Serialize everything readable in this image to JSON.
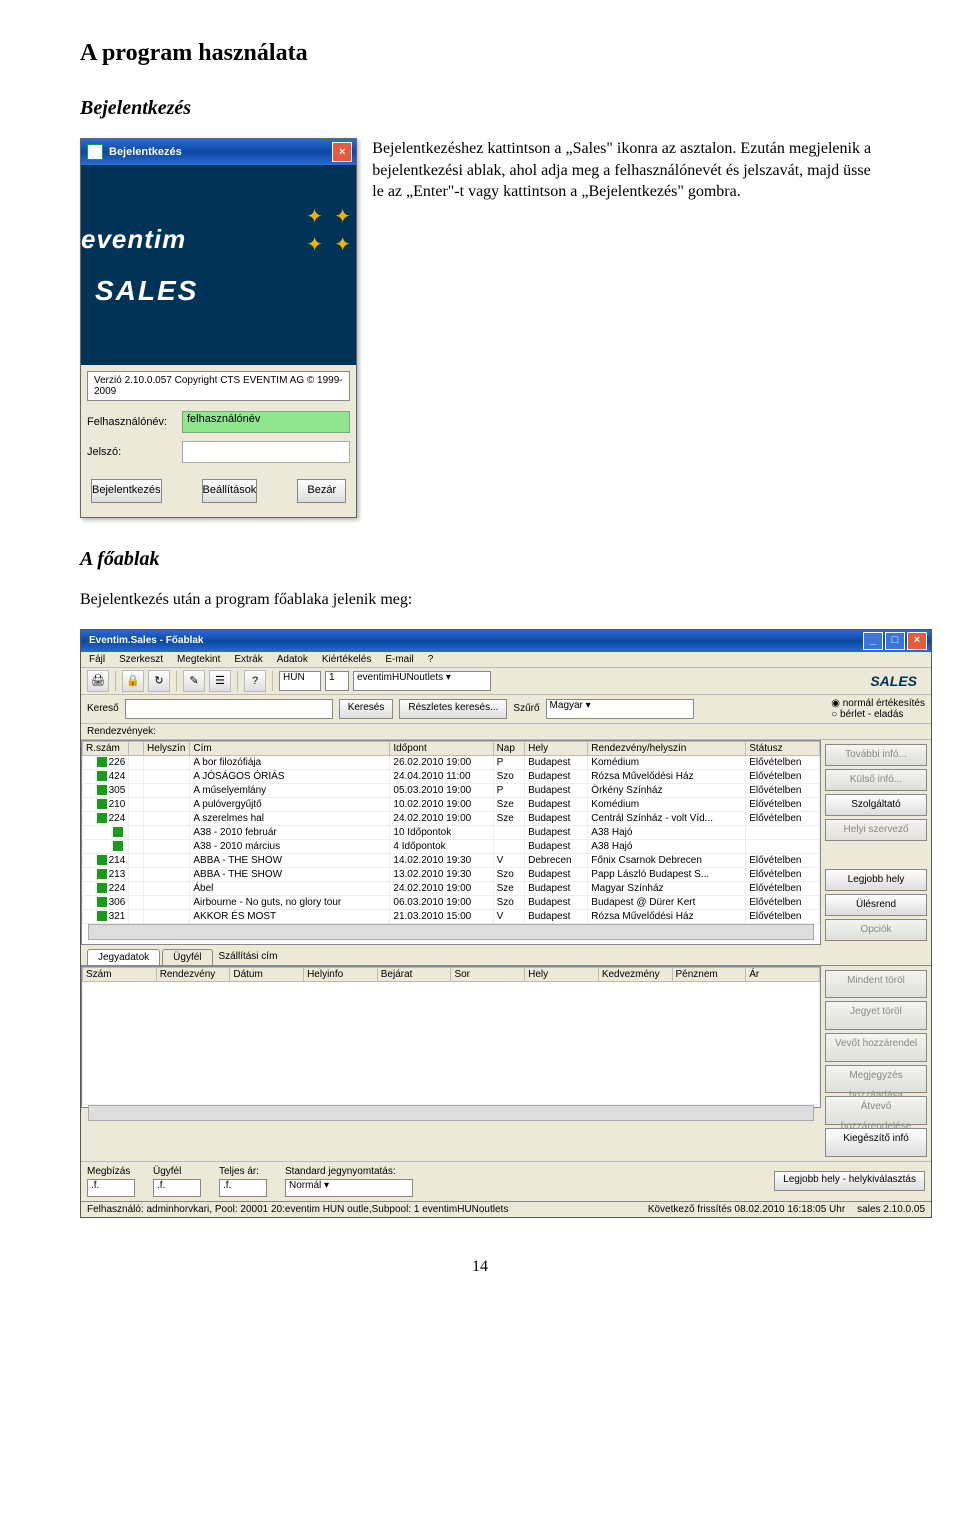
{
  "doc": {
    "title": "A program használata",
    "section1": "Bejelentkezés",
    "para1": "Bejelentkezéshez kattintson a „Sales\" ikonra az asztalon. Ezután megjelenik a bejelentkezési ablak, ahol adja meg a felhasználónevét és jelszavát, majd üsse le az „Enter\"-t vagy kattintson a „Bejelentkezés\" gombra.",
    "section2": "A főablak",
    "para2": "Bejelentkezés után a program főablaka jelenik meg:",
    "page_number": "14"
  },
  "login": {
    "window_title": "Bejelentkezés",
    "brand": "eventim",
    "sales": "SALES",
    "version": "Verzió 2.10.0.057 Copyright CTS EVENTIM AG © 1999-2009",
    "user_label": "Felhasználónév:",
    "user_value": "felhasználónév",
    "pw_label": "Jelszó:",
    "pw_value": "",
    "btn_login": "Bejelentkezés",
    "btn_settings": "Beállítások",
    "btn_close": "Bezár"
  },
  "main": {
    "window_title": "Eventim.Sales - Főablak",
    "menu": [
      "Fájl",
      "Szerkeszt",
      "Megtekint",
      "Extrák",
      "Adatok",
      "Kiértékelés",
      "E-mail",
      "?"
    ],
    "toolbar": {
      "lang": "HUN",
      "one": "1",
      "outlet": "eventimHUNoutlets",
      "sales_logo": "SALES"
    },
    "search": {
      "kereso_label": "Kereső",
      "btn_search": "Keresés",
      "btn_detail": "Részletes keresés...",
      "filter_label": "Szűrő",
      "filter_value": "Magyar",
      "radio1": "normál értékesítés",
      "radio2": "bérlet - eladás"
    },
    "events_label": "Rendezvények:",
    "columns": [
      "R.szám",
      "",
      "Helyszín",
      "Cím",
      "Időpont",
      "Nap",
      "Hely",
      "Rendezvény/helyszín",
      "Státusz"
    ],
    "rows": [
      {
        "n": "226",
        "cim": "A bor filozófiája",
        "ido": "26.02.2010 19:00",
        "nap": "P",
        "hely": "Budapest",
        "rv": "Komédium",
        "st": "Elővételben"
      },
      {
        "n": "424",
        "cim": "A JÓSÁGOS ÓRIÁS",
        "ido": "24.04.2010 11:00",
        "nap": "Szo",
        "hely": "Budapest",
        "rv": "Rózsa Művelődési Ház",
        "st": "Elővételben"
      },
      {
        "n": "305",
        "cim": "A műselyemlány",
        "ido": "05.03.2010 19:00",
        "nap": "P",
        "hely": "Budapest",
        "rv": "Örkény Színház",
        "st": "Elővételben"
      },
      {
        "n": "210",
        "cim": "A pulóvergyűjtő",
        "ido": "10.02.2010 19:00",
        "nap": "Sze",
        "hely": "Budapest",
        "rv": "Komédium",
        "st": "Elővételben"
      },
      {
        "n": "224",
        "cim": "A szerelmes hal",
        "ido": "24.02.2010 19:00",
        "nap": "Sze",
        "hely": "Budapest",
        "rv": "Centrál Színház - volt Víd...",
        "st": "Elővételben"
      },
      {
        "n": "",
        "cim": "A38 - 2010 február",
        "ido": "10 Időpontok",
        "nap": "",
        "hely": "Budapest",
        "rv": "A38 Hajó",
        "st": ""
      },
      {
        "n": "",
        "cim": "A38 - 2010 március",
        "ido": "4 Időpontok",
        "nap": "",
        "hely": "Budapest",
        "rv": "A38 Hajó",
        "st": ""
      },
      {
        "n": "214",
        "cim": "ABBA - THE SHOW",
        "ido": "14.02.2010 19:30",
        "nap": "V",
        "hely": "Debrecen",
        "rv": "Főnix Csarnok Debrecen",
        "st": "Elővételben"
      },
      {
        "n": "213",
        "cim": "ABBA - THE SHOW",
        "ido": "13.02.2010 19:30",
        "nap": "Szo",
        "hely": "Budapest",
        "rv": "Papp László Budapest S...",
        "st": "Elővételben"
      },
      {
        "n": "224",
        "cim": "Ábel",
        "ido": "24.02.2010 19:00",
        "nap": "Sze",
        "hely": "Budapest",
        "rv": "Magyar Színház",
        "st": "Elővételben"
      },
      {
        "n": "306",
        "cim": "Airbourne - No guts, no glory tour",
        "ido": "06.03.2010 19:00",
        "nap": "Szo",
        "hely": "Budapest",
        "rv": "Budapest @ Dürer Kert",
        "st": "Elővételben"
      },
      {
        "n": "321",
        "cim": "AKKOR ÉS MOST",
        "ido": "21.03.2010 15:00",
        "nap": "V",
        "hely": "Budapest",
        "rv": "Rózsa Művelődési Ház",
        "st": "Elővételben"
      }
    ],
    "side_btns_top": [
      {
        "label": "További infó...",
        "dis": true
      },
      {
        "label": "Külső infó...",
        "dis": true
      },
      {
        "label": "Szolgáltató",
        "dis": false
      },
      {
        "label": "Helyi szervező",
        "dis": true
      }
    ],
    "side_btns_mid": [
      {
        "label": "Legjobb hely",
        "dis": false
      },
      {
        "label": "Ülésrend",
        "dis": false
      },
      {
        "label": "Opciók",
        "dis": true
      }
    ],
    "tabs": {
      "t1": "Jegyadatok",
      "t2": "Ügyfél",
      "t3": "Szállítási cím"
    },
    "lower_columns": [
      "Szám",
      "Rendezvény",
      "Dátum",
      "Helyinfo",
      "Bejárat",
      "Sor",
      "Hely",
      "Kedvezmény",
      "Pénznem",
      "Ár"
    ],
    "side_btns_low": [
      {
        "label": "Mindent töröl",
        "dis": true
      },
      {
        "label": "Jegyet töröl",
        "dis": true
      },
      {
        "label": "Vevőt hozzárendel",
        "dis": true
      },
      {
        "label": "Megjegyzés hozzáadása",
        "dis": true
      },
      {
        "label": "Átvevő hozzárendelése",
        "dis": true
      },
      {
        "label": "Kiegészítő infó",
        "dis": false
      }
    ],
    "bottom": {
      "megbizas": "Megbízás",
      "ugyfel": "Ügyfél",
      "teljes": "Teljes ár:",
      "std": "Standard jegynyomtatás:",
      "std_val": "Normál",
      "foot_btn": "Legjobb hely - helykiválasztás",
      "dots": ".f."
    },
    "status": {
      "user": "Felhasználó: adminhorvkari, Pool: 20001 20:eventim HUN outle,Subpool: 1 eventimHUNoutlets",
      "next": "Következő frissítés 08.02.2010 16:18:05 Uhr",
      "ver": "sales 2.10.0.05"
    }
  }
}
